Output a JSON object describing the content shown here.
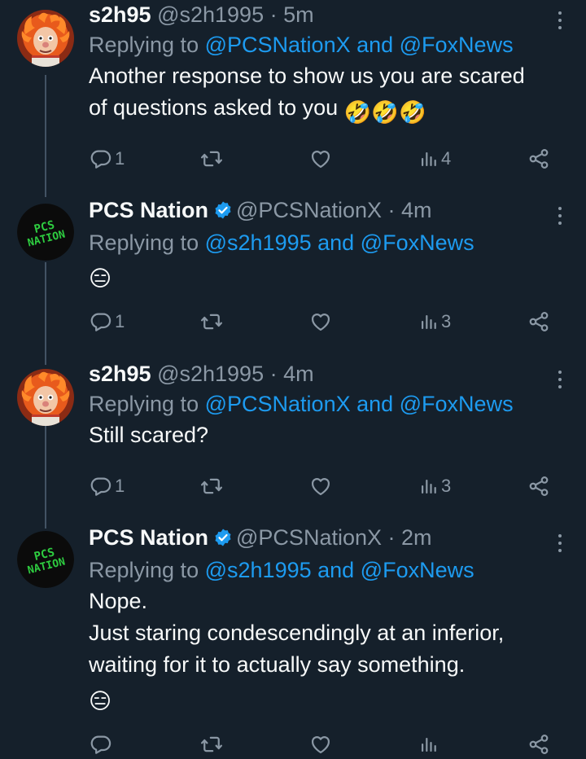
{
  "tweets": [
    {
      "name": "s2h95",
      "handle": "@s2h1995",
      "time": "· 5m",
      "verified": false,
      "replying_prefix": "Replying to",
      "replying_mentions": "@PCSNationX and @FoxNews",
      "text_lines": [
        "Another response to show us you are scared",
        "of questions asked to you"
      ],
      "emoji": "🤣🤣🤣",
      "replies": "1",
      "retweets": "",
      "likes": "",
      "views": "4",
      "avatar": "heat-miser-avatar"
    },
    {
      "name": "PCS Nation",
      "handle": "@PCSNationX",
      "time": "· 4m",
      "verified": true,
      "replying_prefix": "Replying to",
      "replying_mentions": "@s2h1995 and @FoxNews",
      "text_lines": [],
      "emoji": "😑",
      "replies": "1",
      "retweets": "",
      "likes": "",
      "views": "3",
      "avatar": "pcs-nation-avatar"
    },
    {
      "name": "s2h95",
      "handle": "@s2h1995",
      "time": "· 4m",
      "verified": false,
      "replying_prefix": "Replying to",
      "replying_mentions": "@PCSNationX and @FoxNews",
      "text_lines": [
        "Still scared?"
      ],
      "emoji": "",
      "replies": "1",
      "retweets": "",
      "likes": "",
      "views": "3",
      "avatar": "heat-miser-avatar"
    },
    {
      "name": "PCS Nation",
      "handle": "@PCSNationX",
      "time": "· 2m",
      "verified": true,
      "replying_prefix": "Replying to",
      "replying_mentions": "@s2h1995 and @FoxNews",
      "text_lines": [
        "Nope.",
        "Just staring condescendingly at an inferior,",
        "waiting for it to actually say something."
      ],
      "emoji": "😑",
      "replies": "",
      "retweets": "",
      "likes": "",
      "views": "",
      "avatar": "pcs-nation-avatar"
    }
  ],
  "pcs_logo_text": [
    "PCS",
    "NATION"
  ],
  "colors": {
    "background": "#15202b",
    "text": "#f7f9f9",
    "secondary": "#8b98a5",
    "link": "#1d9bf0",
    "verified": "#1d9bf0",
    "thread_line": "#425364",
    "pcs_green": "#2ecc40"
  }
}
